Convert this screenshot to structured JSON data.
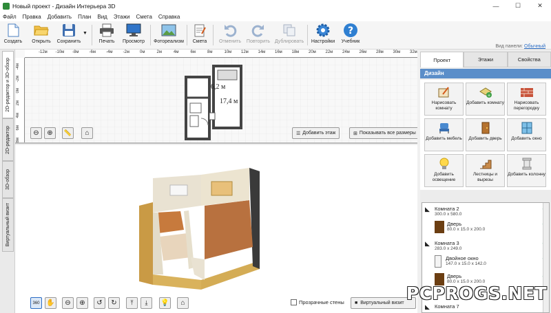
{
  "window": {
    "title": "Новый проект - Дизайн Интерьера 3D",
    "minimize": "—",
    "maximize": "☐",
    "close": "✕"
  },
  "menu": [
    "Файл",
    "Правка",
    "Добавить",
    "План",
    "Вид",
    "Этажи",
    "Смета",
    "Справка"
  ],
  "toolbar": {
    "create": "Создать",
    "open": "Открыть",
    "save": "Сохранить",
    "print": "Печать",
    "preview": "Просмотр",
    "photoreal": "Фотореализм",
    "estimate": "Смета",
    "undo": "Отменить",
    "redo": "Повторить",
    "duplicate": "Дублировать",
    "settings": "Настройки",
    "tutorial": "Учебник",
    "panel_view_label": "Вид панели:",
    "panel_view_value": "Обычный"
  },
  "left_tabs": [
    "2D-редактор и 3D-обзор",
    "2D-редактор",
    "3D-обзор",
    "Виртуальный визит"
  ],
  "ruler_h": [
    "-12м",
    "-10м",
    "-8м",
    "-6м",
    "-4м",
    "-2м",
    "0м",
    "2м",
    "4м",
    "6м",
    "8м",
    "10м",
    "12м",
    "14м",
    "16м",
    "18м",
    "20м",
    "22м",
    "24м",
    "26м",
    "28м",
    "30м",
    "32м"
  ],
  "ruler_v": [
    "-4м",
    "-2м",
    "0м",
    "2м",
    "4м",
    "6м",
    "8м"
  ],
  "plan": {
    "room1_area": "6,2 м",
    "room2_area": "17,4 м"
  },
  "plan_buttons": {
    "add_floor": "Добавить этаж",
    "show_all_dims": "Показывать все размеры"
  },
  "view3d": {
    "transparent_walls": "Прозрачные стены",
    "virtual_visit": "Виртуальный визит"
  },
  "right_tabs": [
    "Проект",
    "Этажи",
    "Свойства"
  ],
  "design": {
    "header": "Дизайн",
    "items": [
      "Нарисовать комнату",
      "Добавить комнату",
      "Нарисовать перегородку",
      "Добавить мебель",
      "Добавить дверь",
      "Добавить окно",
      "Добавить освещение",
      "Лестницы и вырезы",
      "Добавить колонну"
    ]
  },
  "objects": [
    {
      "name": "Комната 2",
      "size": "300.0 x 580.0",
      "level": 0
    },
    {
      "name": "Дверь",
      "size": "80.0 x 15.0 x 200.0",
      "level": 1
    },
    {
      "name": "Комната 3",
      "size": "283.0 x 249.0",
      "level": 0
    },
    {
      "name": "Двойное окно",
      "size": "147.0 x 15.0 x 142.0",
      "level": 1
    },
    {
      "name": "Дверь",
      "size": "80.0 x 15.0 x 200.0",
      "level": 1
    },
    {
      "name": "Комната 7",
      "size": "",
      "level": 0
    }
  ],
  "watermark": "PCPROGS.NET",
  "colors": {
    "accent": "#5b8ec9",
    "wall_brick": "#d9b25c",
    "floor_wood": "#b8713f",
    "wallpaper": "#e9e2d2"
  }
}
